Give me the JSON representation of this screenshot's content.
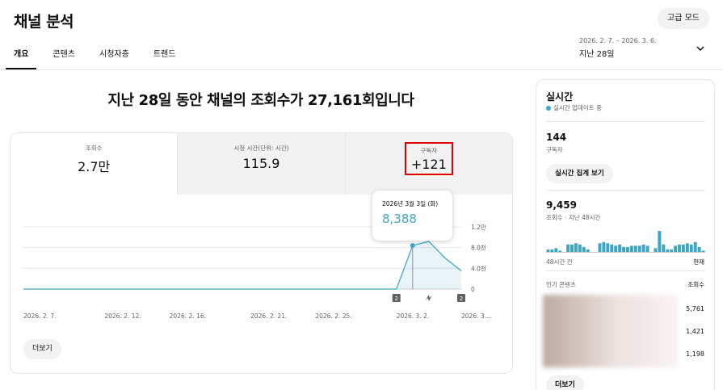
{
  "header": {
    "title": "채널 분석",
    "advanced_mode_label": "고급 모드"
  },
  "tabs": [
    {
      "label": "개요",
      "active": true
    },
    {
      "label": "콘텐츠",
      "active": false
    },
    {
      "label": "시청자층",
      "active": false
    },
    {
      "label": "트렌드",
      "active": false
    }
  ],
  "date_range": {
    "range": "2026. 2. 7. – 2026. 3. 6.",
    "label": "지난 28일"
  },
  "headline": "지난 28일 동안 채널의 조회수가 27,161회입니다",
  "metrics": [
    {
      "label": "조회수",
      "value": "2.7만"
    },
    {
      "label": "시청 시간(단위: 시간)",
      "value": "115.9"
    },
    {
      "label": "구독자",
      "value": "+121"
    }
  ],
  "tooltip": {
    "date": "2026년 3월 3일 (화)",
    "value": "8,388"
  },
  "chart_data": {
    "type": "area",
    "series": [
      {
        "values": [
          0,
          0,
          0,
          0,
          0,
          0,
          0,
          0,
          0,
          0,
          0,
          0,
          0,
          0,
          0,
          0,
          0,
          0,
          0,
          0,
          0,
          0,
          0,
          0,
          8388,
          9200,
          6000,
          3500
        ]
      }
    ],
    "x_tick_labels": [
      "2026. 2. 7.",
      "2026. 2. 12.",
      "2026. 2. 16.",
      "2026. 2. 21.",
      "2026. 2. 25.",
      "2026. 3. 2.",
      "2026. 3...."
    ],
    "y_tick_labels": [
      "1.2만",
      "8.0천",
      "4.0천",
      "0"
    ],
    "ylim": [
      0,
      12000
    ],
    "grid": true,
    "markers": [
      {
        "label": "2",
        "day_index": 23
      },
      {
        "label": "2",
        "day_index": 27
      }
    ],
    "color": "#3ea6c4"
  },
  "more_label": "더보기",
  "realtime": {
    "title": "실시간",
    "subtitle": "실시간 업데이트 중",
    "subscribers_value": "144",
    "subscribers_label": "구독자",
    "realtime_button": "실시간 집계 보기",
    "views_value": "9,459",
    "views_label": "조회수 · 지난 48시간",
    "hourly_views": [
      2,
      2,
      3,
      1,
      0,
      6,
      6,
      7,
      6,
      4,
      2,
      0,
      0,
      7,
      8,
      7,
      6,
      5,
      6,
      4,
      4,
      5,
      5,
      5,
      6,
      5,
      0,
      3,
      17,
      6,
      2,
      2,
      5,
      6,
      6,
      7,
      6,
      8,
      4,
      1
    ],
    "axis_start": "48시간 전",
    "axis_end": "현재",
    "top_content_label": "인기 콘텐츠",
    "views_column_label": "조회수",
    "top_content_views": [
      "5,761",
      "1,421",
      "1,198"
    ],
    "more_label": "더보기"
  }
}
